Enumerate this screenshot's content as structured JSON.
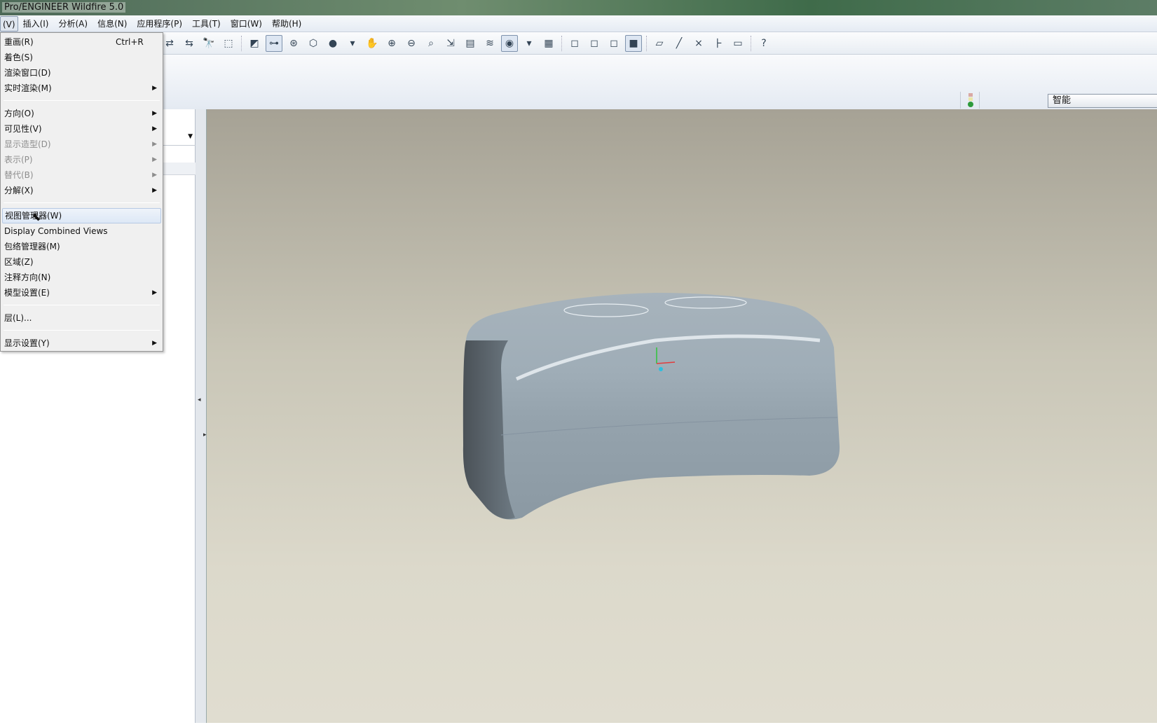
{
  "window": {
    "title": "Pro/ENGINEER Wildfire 5.0"
  },
  "menubar": [
    {
      "label": "(V)",
      "active": true
    },
    {
      "label": "插入(I)"
    },
    {
      "label": "分析(A)"
    },
    {
      "label": "信息(N)"
    },
    {
      "label": "应用程序(P)"
    },
    {
      "label": "工具(T)"
    },
    {
      "label": "窗口(W)"
    },
    {
      "label": "帮助(H)"
    }
  ],
  "toolbar": [
    {
      "icon": "regenerate-list-icon",
      "glyph": "⇄"
    },
    {
      "icon": "regenerate-manager-icon",
      "glyph": "⇆"
    },
    {
      "icon": "find-icon",
      "glyph": "🔭"
    },
    {
      "icon": "select-box-icon",
      "glyph": "⬚"
    },
    {
      "icon": "sep"
    },
    {
      "icon": "named-view-icon",
      "glyph": "◩"
    },
    {
      "icon": "datum-display-icon",
      "glyph": "⊶",
      "on": true
    },
    {
      "icon": "spin-center-icon",
      "glyph": "⊛"
    },
    {
      "icon": "orient-mode-icon",
      "glyph": "⬡"
    },
    {
      "icon": "shading-icon",
      "glyph": "●"
    },
    {
      "icon": "dropdown-icon",
      "glyph": "▾"
    },
    {
      "icon": "pan-hand-icon",
      "glyph": "✋"
    },
    {
      "icon": "zoom-in-icon",
      "glyph": "⊕"
    },
    {
      "icon": "zoom-out-icon",
      "glyph": "⊖"
    },
    {
      "icon": "refit-icon",
      "glyph": "⌕"
    },
    {
      "icon": "reorient-icon",
      "glyph": "⇲"
    },
    {
      "icon": "saved-views-icon",
      "glyph": "▤"
    },
    {
      "icon": "layers-icon",
      "glyph": "≋"
    },
    {
      "icon": "appearance-icon",
      "glyph": "◉",
      "on": true
    },
    {
      "icon": "dropdown-icon",
      "glyph": "▾"
    },
    {
      "icon": "model-tree-settings-icon",
      "glyph": "▦"
    },
    {
      "icon": "sep"
    },
    {
      "icon": "wireframe-icon",
      "glyph": "◻"
    },
    {
      "icon": "hidden-line-icon",
      "glyph": "◻"
    },
    {
      "icon": "no-hidden-icon",
      "glyph": "◻"
    },
    {
      "icon": "shaded-icon",
      "glyph": "■",
      "on": true
    },
    {
      "icon": "sep"
    },
    {
      "icon": "datum-plane-icon",
      "glyph": "▱"
    },
    {
      "icon": "datum-axis-icon",
      "glyph": "╱"
    },
    {
      "icon": "datum-point-icon",
      "glyph": "×"
    },
    {
      "icon": "coordinate-system-icon",
      "glyph": "⺊"
    },
    {
      "icon": "annotation-icon",
      "glyph": "▭"
    },
    {
      "icon": "sep"
    },
    {
      "icon": "context-help-icon",
      "glyph": "?"
    }
  ],
  "status": {
    "filter_value": "智能"
  },
  "view_menu": {
    "items": [
      {
        "label": "重画(R)",
        "shortcut": "Ctrl+R"
      },
      {
        "label": "着色(S)"
      },
      {
        "label": "渲染窗口(D)"
      },
      {
        "label": "实时渲染(M)",
        "submenu": true
      },
      {
        "sep": true
      },
      {
        "label": "方向(O)",
        "submenu": true
      },
      {
        "label": "可见性(V)",
        "submenu": true
      },
      {
        "label": "显示造型(D)",
        "submenu": true,
        "disabled": true
      },
      {
        "label": "表示(P)",
        "submenu": true,
        "disabled": true
      },
      {
        "label": "替代(B)",
        "submenu": true,
        "disabled": true
      },
      {
        "label": "分解(X)",
        "submenu": true
      },
      {
        "sep": true
      },
      {
        "label": "视图管理器(W)",
        "highlighted": true
      },
      {
        "label": "Display Combined Views"
      },
      {
        "label": "包络管理器(M)"
      },
      {
        "label": "区域(Z)"
      },
      {
        "label": "注释方向(N)"
      },
      {
        "label": "模型设置(E)",
        "submenu": true
      },
      {
        "sep": true
      },
      {
        "label": "层(L)..."
      },
      {
        "sep": true
      },
      {
        "label": "显示设置(Y)",
        "submenu": true
      }
    ]
  },
  "colors": {
    "model": "#9aa8b2",
    "viewport_top": "#a6a295",
    "viewport_bottom": "#e0ddd0"
  }
}
